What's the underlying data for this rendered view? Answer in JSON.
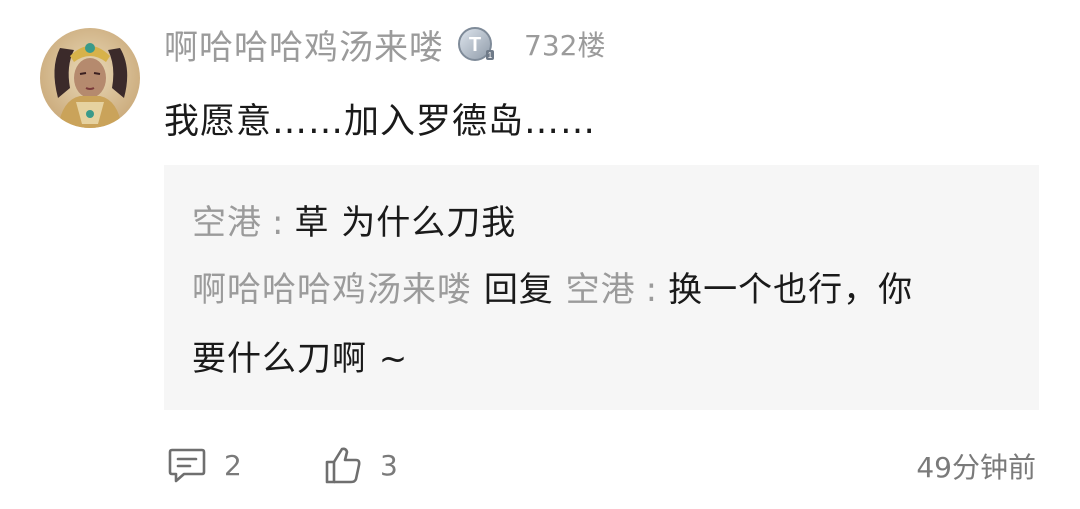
{
  "comment": {
    "username": "啊哈哈哈鸡汤来喽",
    "badge_icon": "level-badge-icon",
    "floor": "732楼",
    "text": "我愿意……加入罗德岛……"
  },
  "replies": [
    {
      "user": "空港",
      "separator": ":",
      "text": "草 为什么刀我"
    },
    {
      "user": "啊哈哈哈鸡汤来喽",
      "reply_word": "回复",
      "reply_to": "空港",
      "separator": ":",
      "text_line1": "换一个也行，你",
      "text_line2": "要什么刀啊 ~"
    }
  ],
  "footer": {
    "comment_icon": "comment-icon",
    "comment_count": "2",
    "like_icon": "thumbs-up-icon",
    "like_count": "3",
    "time": "49分钟前"
  },
  "colors": {
    "muted": "#9b9b9b",
    "text": "#1a1a1a",
    "reply_bg": "#f6f6f6",
    "footer_text": "#7a7a7a"
  }
}
